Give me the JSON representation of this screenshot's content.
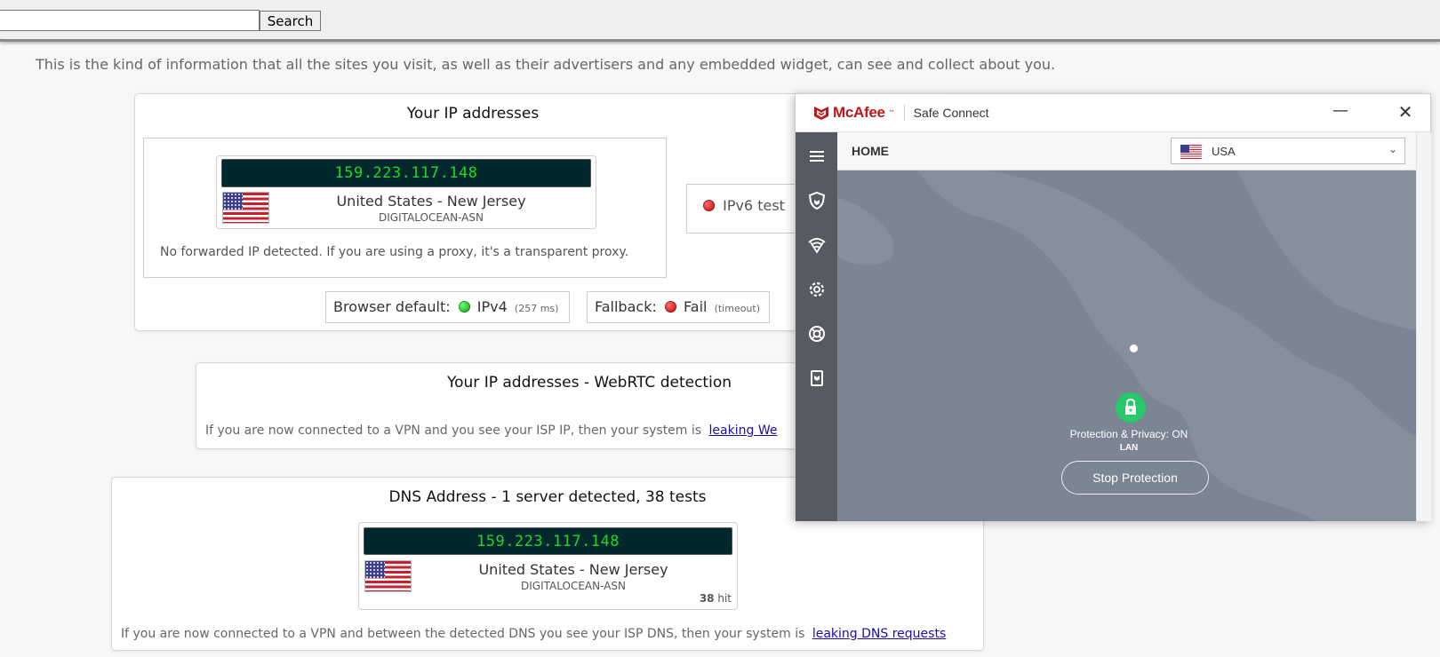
{
  "search": {
    "placeholder": "",
    "value": "",
    "button_label": "Search"
  },
  "intro_text": "This is the kind of information that all the sites you visit, as well as their advertisers and any embedded widget, can see and collect about you.",
  "ip_card": {
    "title": "Your IP addresses",
    "ip": "159.223.117.148",
    "location": "United States - New Jersey",
    "asn": "DIGITALOCEAN-ASN",
    "forward_note": "No forwarded IP detected. If you are using a proxy, it's a transparent proxy.",
    "ipv6_label": "IPv6 test",
    "browser_default_label": "Browser default:",
    "browser_default_value": "IPv4",
    "browser_default_time": "(257 ms)",
    "fallback_label": "Fallback:",
    "fallback_value": "Fail",
    "fallback_note": "(timeout)"
  },
  "webrtc_card": {
    "title": "Your IP addresses - WebRTC detection",
    "note_prefix": "If you are now connected to a VPN and you see your ISP IP, then your system is",
    "note_link": "leaking We"
  },
  "dns_card": {
    "title": "DNS Address - 1 server detected, 38 tests",
    "ip": "159.223.117.148",
    "location": "United States - New Jersey",
    "asn": "DIGITALOCEAN-ASN",
    "hits_count": "38",
    "hits_label": "hit",
    "note_prefix": "If you are now connected to a VPN and between the detected DNS you see your ISP DNS, then your system is",
    "note_link": "leaking DNS requests"
  },
  "mcafee": {
    "brand": "McAfee",
    "trademark": "™",
    "product": "Safe Connect",
    "minimize_label": "—",
    "close_label": "✕",
    "home_label": "HOME",
    "country": "USA",
    "status": "Protection & Privacy: ON",
    "network": "LAN",
    "stop_button": "Stop Protection",
    "nav_icons": [
      "menu-icon",
      "shield-icon",
      "wifi-icon",
      "gear-icon",
      "lifebuoy-icon",
      "document-icon"
    ]
  },
  "colors": {
    "ip_text": "#22d42b",
    "ip_background": "#02282e",
    "mcafee_red": "#c01818",
    "map_water": "#7b8593",
    "map_land": "#868f9c",
    "sidebar": "#575b61",
    "lock_green": "#28c86b"
  }
}
